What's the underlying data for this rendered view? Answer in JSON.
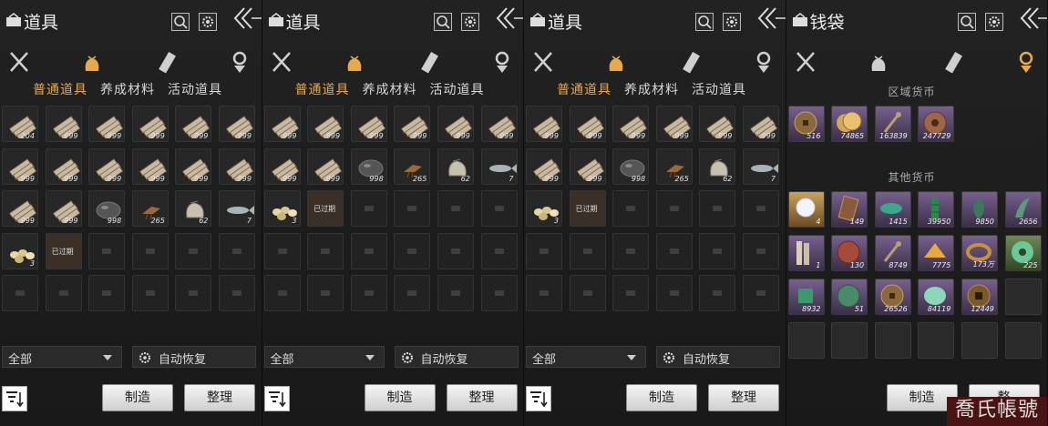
{
  "panels": [
    {
      "title": "道具",
      "subtabs": [
        "普通道具",
        "养成材料",
        "活动道具"
      ],
      "active_subtab": 0,
      "active_category": 1,
      "filter": "全部",
      "auto_label": "自动恢复",
      "craft_label": "制造",
      "sort_label": "整理",
      "items": [
        {
          "icon": "wood-bundle",
          "qty": "204"
        },
        {
          "icon": "wood-bundle",
          "qty": "999"
        },
        {
          "icon": "wood-bundle",
          "qty": "999"
        },
        {
          "icon": "wood-bundle",
          "qty": "999"
        },
        {
          "icon": "wood-bundle",
          "qty": "999"
        },
        {
          "icon": "wood-bundle",
          "qty": "999"
        },
        {
          "icon": "wood-bundle",
          "qty": "999"
        },
        {
          "icon": "wood-bundle",
          "qty": "999"
        },
        {
          "icon": "wood-bundle",
          "qty": "999"
        },
        {
          "icon": "wood-bundle",
          "qty": "999"
        },
        {
          "icon": "wood-bundle",
          "qty": "999"
        },
        {
          "icon": "wood-bundle",
          "qty": "999"
        },
        {
          "icon": "wood-bundle",
          "qty": "999"
        },
        {
          "icon": "wood-bundle",
          "qty": "999"
        },
        {
          "icon": "ore",
          "qty": "998"
        },
        {
          "icon": "bird",
          "qty": "265"
        },
        {
          "icon": "sack",
          "qty": "62"
        },
        {
          "icon": "fish",
          "qty": "7"
        },
        {
          "icon": "eggs",
          "qty": "3"
        },
        {
          "icon": "expired",
          "text": "已过期"
        }
      ]
    },
    {
      "title": "道具",
      "subtabs": [
        "普通道具",
        "养成材料",
        "活动道具"
      ],
      "active_subtab": 0,
      "active_category": 1,
      "filter": "全部",
      "auto_label": "自动恢复",
      "craft_label": "制造",
      "sort_label": "整理",
      "items": [
        {
          "icon": "wood-bundle",
          "qty": "999"
        },
        {
          "icon": "wood-bundle",
          "qty": "999"
        },
        {
          "icon": "wood-bundle",
          "qty": "999"
        },
        {
          "icon": "wood-bundle",
          "qty": "999"
        },
        {
          "icon": "wood-bundle",
          "qty": "999"
        },
        {
          "icon": "wood-bundle",
          "qty": "999"
        },
        {
          "icon": "wood-bundle",
          "qty": "999"
        },
        {
          "icon": "wood-bundle",
          "qty": "999"
        },
        {
          "icon": "ore",
          "qty": "998"
        },
        {
          "icon": "bird",
          "qty": "265"
        },
        {
          "icon": "sack",
          "qty": "62"
        },
        {
          "icon": "fish",
          "qty": "7"
        },
        {
          "icon": "eggs",
          "qty": "3"
        },
        {
          "icon": "expired",
          "text": "已过期"
        }
      ]
    },
    {
      "title": "道具",
      "subtabs": [
        "普通道具",
        "养成材料",
        "活动道具"
      ],
      "active_subtab": 0,
      "active_category": 1,
      "filter": "全部",
      "auto_label": "自动恢复",
      "craft_label": "制造",
      "sort_label": "整理",
      "items": [
        {
          "icon": "wood-bundle",
          "qty": "999"
        },
        {
          "icon": "wood-bundle",
          "qty": "999"
        },
        {
          "icon": "wood-bundle",
          "qty": "999"
        },
        {
          "icon": "wood-bundle",
          "qty": "999"
        },
        {
          "icon": "wood-bundle",
          "qty": "999"
        },
        {
          "icon": "wood-bundle",
          "qty": "999"
        },
        {
          "icon": "wood-bundle",
          "qty": "999"
        },
        {
          "icon": "wood-bundle",
          "qty": "999"
        },
        {
          "icon": "ore",
          "qty": "998"
        },
        {
          "icon": "bird",
          "qty": "265"
        },
        {
          "icon": "sack",
          "qty": "62"
        },
        {
          "icon": "fish",
          "qty": "7"
        },
        {
          "icon": "eggs",
          "qty": "3"
        },
        {
          "icon": "expired",
          "text": "已过期"
        }
      ]
    }
  ],
  "wallet": {
    "title": "钱袋",
    "active_category": 3,
    "region_label": "区域货币",
    "other_label": "其他货币",
    "craft_label": "制造",
    "sort_label": "整",
    "region_items": [
      {
        "icon": "coin-bronze",
        "qty": "516",
        "rarity": "purple"
      },
      {
        "icon": "coin-gold",
        "qty": "74865",
        "rarity": "purple"
      },
      {
        "icon": "key",
        "qty": "163839",
        "rarity": "purple"
      },
      {
        "icon": "coin-copper",
        "qty": "247729",
        "rarity": "purple"
      }
    ],
    "other_items": [
      {
        "icon": "pearl",
        "qty": "4",
        "rarity": "gold"
      },
      {
        "icon": "plaque",
        "qty": "149",
        "rarity": "purple"
      },
      {
        "icon": "fish-token",
        "qty": "1415",
        "rarity": "purple"
      },
      {
        "icon": "bamboo",
        "qty": "39950",
        "rarity": "purple"
      },
      {
        "icon": "leaf-token",
        "qty": "9850",
        "rarity": "purple"
      },
      {
        "icon": "claw",
        "qty": "2656",
        "rarity": "purple"
      },
      {
        "icon": "talisman",
        "qty": "1",
        "rarity": "purple"
      },
      {
        "icon": "red-coin",
        "qty": "130",
        "rarity": "purple"
      },
      {
        "icon": "key",
        "qty": "8749",
        "rarity": "purple"
      },
      {
        "icon": "fan",
        "qty": "7775",
        "rarity": "purple"
      },
      {
        "icon": "bracelet",
        "qty": "173万",
        "rarity": "purple"
      },
      {
        "icon": "jade-disc",
        "qty": "225",
        "rarity": "green"
      },
      {
        "icon": "jade-token",
        "qty": "8932",
        "rarity": "purple"
      },
      {
        "icon": "green-stone",
        "qty": "51",
        "rarity": "purple"
      },
      {
        "icon": "coin-bronze",
        "qty": "26526",
        "rarity": "purple"
      },
      {
        "icon": "jade-stone",
        "qty": "84119",
        "rarity": "purple"
      },
      {
        "icon": "square-coin",
        "qty": "12449",
        "rarity": "purple"
      }
    ]
  },
  "watermark": "喬氏帳號"
}
